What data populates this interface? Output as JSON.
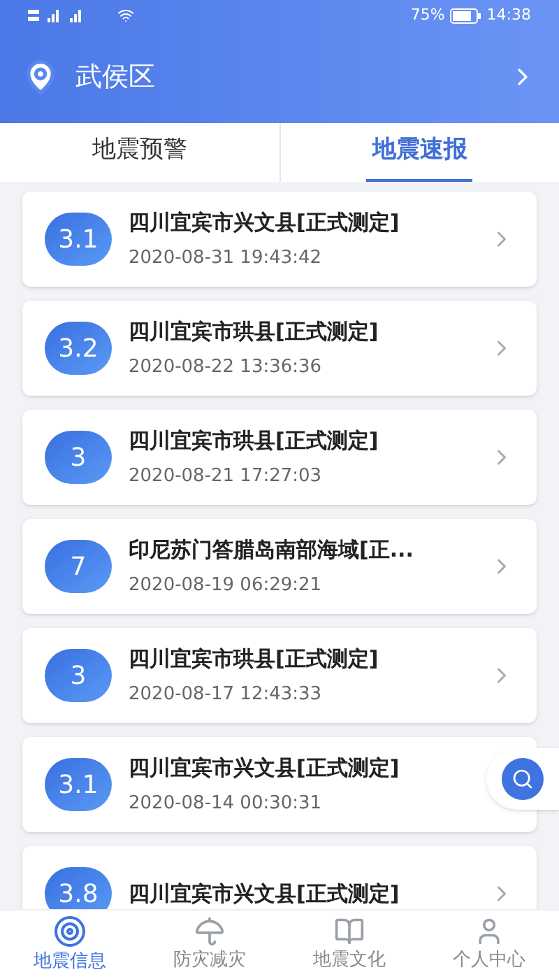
{
  "status_bar": {
    "battery": "75%",
    "time": "14:38"
  },
  "location": {
    "name": "武侯区"
  },
  "tabs": [
    {
      "label": "地震预警",
      "selected": false
    },
    {
      "label": "地震速报",
      "selected": true
    }
  ],
  "quakes": [
    {
      "magnitude": "3.1",
      "place": "四川宜宾市兴文县[正式测定]",
      "time": "2020-08-31 19:43:42"
    },
    {
      "magnitude": "3.2",
      "place": "四川宜宾市珙县[正式测定]",
      "time": "2020-08-22 13:36:36"
    },
    {
      "magnitude": "3",
      "place": "四川宜宾市珙县[正式测定]",
      "time": "2020-08-21 17:27:03"
    },
    {
      "magnitude": "7",
      "place": "印尼苏门答腊岛南部海域[正...",
      "time": "2020-08-19 06:29:21"
    },
    {
      "magnitude": "3",
      "place": "四川宜宾市珙县[正式测定]",
      "time": "2020-08-17 12:43:33"
    },
    {
      "magnitude": "3.1",
      "place": "四川宜宾市兴文县[正式测定]",
      "time": "2020-08-14 00:30:31"
    },
    {
      "magnitude": "3.8",
      "place": "四川宜宾市兴文县[正式测定]"
    }
  ],
  "nav": [
    {
      "label": "地震信息",
      "selected": true
    },
    {
      "label": "防灾减灾",
      "selected": false
    },
    {
      "label": "地震文化",
      "selected": false
    },
    {
      "label": "个人中心",
      "selected": false
    }
  ]
}
